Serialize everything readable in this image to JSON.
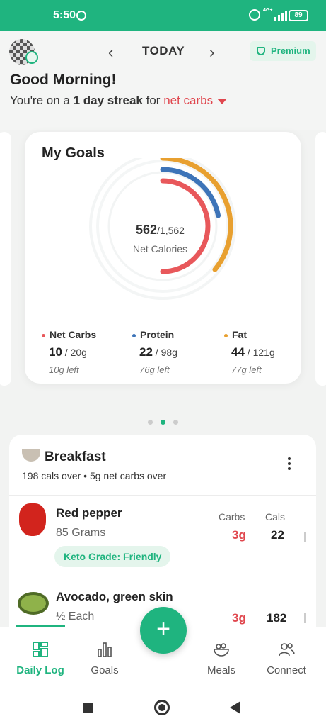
{
  "status": {
    "time": "5:50",
    "network": "4G+",
    "battery": "89"
  },
  "header": {
    "date_label": "TODAY",
    "premium_label": "Premium"
  },
  "greeting": {
    "title": "Good Morning!",
    "streak_prefix": "You're on a",
    "streak_bold": "1 day streak",
    "streak_for": "for",
    "streak_metric": "net carbs"
  },
  "goals": {
    "title": "My Goals",
    "calories_value": "562",
    "calories_target": "/1,562",
    "calories_label": "Net Calories",
    "rings": [
      {
        "name": "Net Carbs",
        "progress": 0.5,
        "color": "#e8585b"
      },
      {
        "name": "Protein",
        "progress": 0.22,
        "color": "#3d74b8"
      },
      {
        "name": "Fat",
        "progress": 0.36,
        "color": "#e8a030"
      },
      {
        "name": "Net Calories",
        "progress": 0.36
      }
    ],
    "macros": [
      {
        "name": "Net Carbs",
        "value": "10",
        "target": " / 20g",
        "left": "10g left",
        "color": "#e8585b"
      },
      {
        "name": "Protein",
        "value": "22",
        "target": " / 98g",
        "left": "76g left",
        "color": "#3d74b8"
      },
      {
        "name": "Fat",
        "value": "44",
        "target": " / 121g",
        "left": "77g left",
        "color": "#e8a030"
      }
    ]
  },
  "carousel": {
    "active_index": 1,
    "count": 3
  },
  "breakfast": {
    "title": "Breakfast",
    "summary": "198 cals over • 5g net carbs over",
    "col_carbs": "Carbs",
    "col_cals": "Cals",
    "items": [
      {
        "name": "Red pepper",
        "quantity": "85 Grams",
        "carbs": "3g",
        "cals": "22",
        "grade": "Keto Grade: Friendly"
      },
      {
        "name": "Avocado, green skin",
        "quantity": "½ Each",
        "carbs": "3g",
        "cals": "182"
      }
    ]
  },
  "tabs": [
    {
      "label": "Daily Log",
      "active": true
    },
    {
      "label": "Goals"
    },
    {
      "label": "Meals"
    },
    {
      "label": "Connect"
    }
  ],
  "colors": {
    "brand": "#1fb47f",
    "carbs": "#e0474e"
  },
  "icons": [
    "whatsapp-icon",
    "alarm-icon",
    "signal-icon",
    "battery-icon",
    "gear-icon",
    "trophy-icon",
    "coffee-cup-icon",
    "more-vert-icon",
    "plus-icon",
    "daily-log-icon",
    "goals-icon",
    "meals-icon",
    "connect-icon"
  ]
}
